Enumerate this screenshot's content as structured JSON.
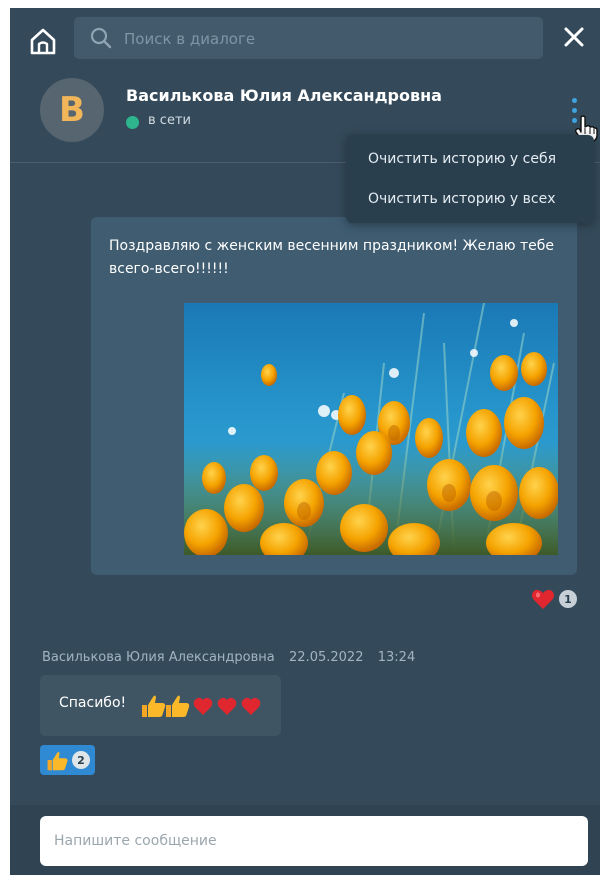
{
  "search": {
    "placeholder": "Поиск в диалоге"
  },
  "contact": {
    "initial": "В",
    "name": "Василькова Юлия Александровна",
    "status": "в сети"
  },
  "menu": {
    "items": [
      {
        "label": "Очистить историю у себя"
      },
      {
        "label": "Очистить историю у всех"
      }
    ]
  },
  "messages": {
    "incoming": {
      "text": "Поздравляю с женским весенним праздником! Желаю тебе всего-всего!!!!!!",
      "reaction_count": "1"
    },
    "reply": {
      "author": "Василькова Юлия Александровна",
      "date": "22.05.2022",
      "time": "13:24",
      "text": "Спасибо!",
      "reaction_count": "2"
    }
  },
  "composer": {
    "placeholder": "Напишите сообщение"
  },
  "colors": {
    "panel": "#344a5a",
    "accent": "#3fa3e0",
    "online": "#2fb58e",
    "avatar_letter": "#f1b65a"
  },
  "icons": {
    "home": "home-icon",
    "search": "search-icon",
    "close": "close-icon",
    "menu": "more-vertical-icon",
    "heart": "heart-icon",
    "thumbs_up": "thumbs-up-icon"
  }
}
